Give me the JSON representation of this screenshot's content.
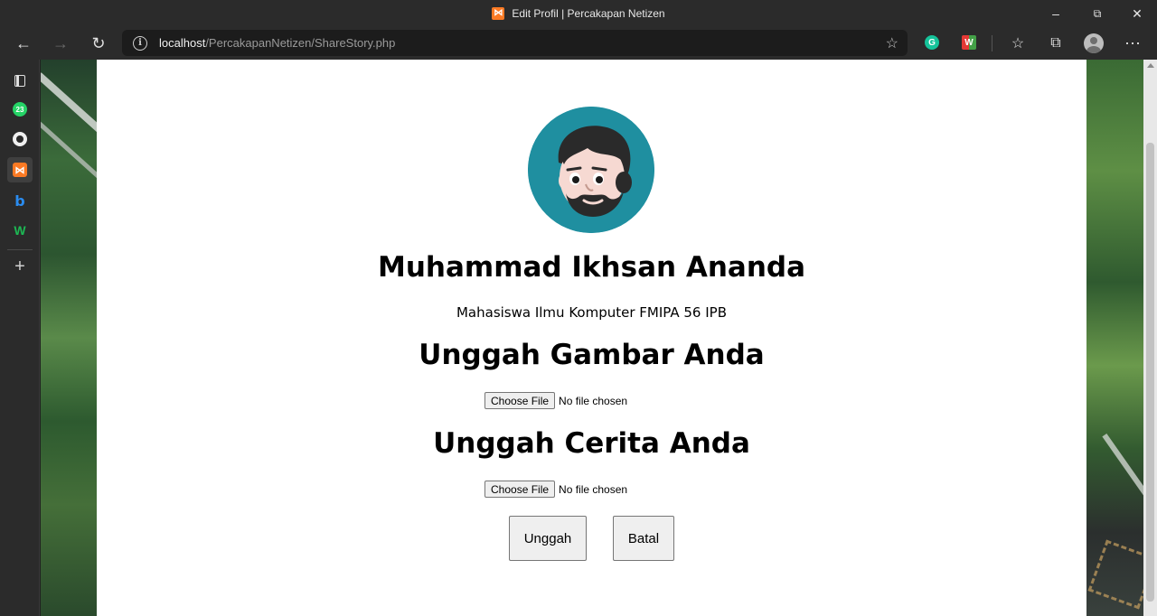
{
  "browser": {
    "tab_title": "Edit Profil | Percakapan Netizen",
    "url_host": "localhost",
    "url_path": "/PercakapanNetizen/ShareStory.php",
    "window_controls": {
      "minimize": "–",
      "maximize": "⧉",
      "close": "✕"
    },
    "nav_icons": {
      "back": "←",
      "forward": "→",
      "refresh": "↻",
      "favorite": "☆",
      "favorites_list": "☆",
      "collections": "⧉",
      "more": "⋯"
    },
    "extensions": [
      "grammarly-icon",
      "multicolor-extension-icon"
    ]
  },
  "sidebar": {
    "items": [
      {
        "name": "tab-actions-icon"
      },
      {
        "name": "whatsapp-icon",
        "badge": "23"
      },
      {
        "name": "github-icon"
      },
      {
        "name": "xampp-icon",
        "active": true
      },
      {
        "name": "bing-icon",
        "label": "b"
      },
      {
        "name": "w-app-icon",
        "label": "W"
      },
      {
        "name": "add-icon",
        "label": "+"
      }
    ]
  },
  "page": {
    "name": "Muhammad Ikhsan Ananda",
    "description": "Mahasiswa Ilmu Komputer FMIPA 56 IPB",
    "image_section_title": "Unggah Gambar Anda",
    "story_section_title": "Unggah Cerita Anda",
    "file_button_label": "Choose File",
    "no_file_text": "No file chosen",
    "upload_button": "Unggah",
    "cancel_button": "Batal"
  },
  "colors": {
    "avatar_bg": "#1f8fa0",
    "xampp_orange": "#fb7a24"
  }
}
